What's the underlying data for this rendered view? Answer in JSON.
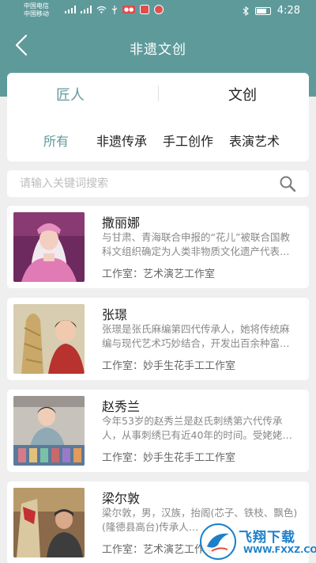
{
  "status_bar": {
    "carrier1": "中国电信",
    "carrier2": "中国移动",
    "time": "4:28"
  },
  "header": {
    "title": "非遗文创"
  },
  "tabs": {
    "main": [
      {
        "label": "匠人",
        "active": true
      },
      {
        "label": "文创",
        "active": false
      }
    ],
    "categories": [
      {
        "label": "所有",
        "active": true
      },
      {
        "label": "非遗传承",
        "active": false
      },
      {
        "label": "手工创作",
        "active": false
      },
      {
        "label": "表演艺术",
        "active": false
      }
    ]
  },
  "search": {
    "placeholder": "请输入关键词搜索",
    "value": ""
  },
  "artisans": [
    {
      "name": "撒丽娜",
      "description": "与甘肃、青海联合申报的“花儿”被联合国教科文组织确定为人类非物质文化遗产代表…",
      "studio": "工作室：艺术演艺工作室"
    },
    {
      "name": "张璟",
      "description": "张璟是张氏麻编第四代传承人，她将传统麻编与现代艺术巧妙结合，开发出百余种富…",
      "studio": "工作室：妙手生花手工工作室"
    },
    {
      "name": "赵秀兰",
      "description": "今年53岁的赵秀兰是赵氏刺绣第六代传承人，从事刺绣已有近40年的时间。受姥姥…",
      "studio": "工作室：妙手生花手工工作室"
    },
    {
      "name": "梁尔敦",
      "description": "梁尔敦，男，汉族，抬阁(芯子、铁枝、飘色)(隆德县高台)传承人…",
      "studio": "工作室：艺术演艺工作室"
    }
  ],
  "watermark": {
    "text": "飞翔下载",
    "url": "WWW.FXXZ.COM"
  },
  "colors": {
    "accent": "#5f9a9b",
    "background": "#efefef",
    "watermark": "#1c7fc9"
  }
}
